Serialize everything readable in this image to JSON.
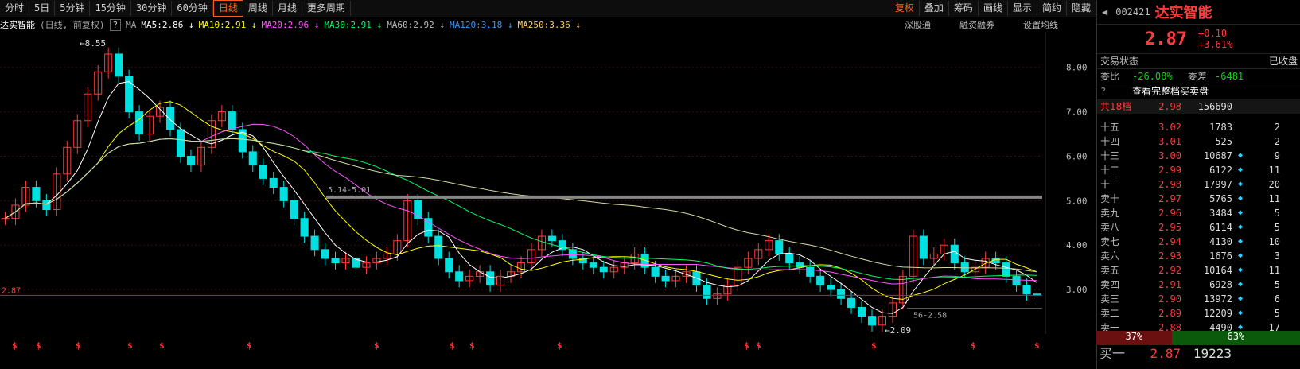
{
  "toolbar": {
    "periods": [
      "分时",
      "5日",
      "5分钟",
      "15分钟",
      "30分钟",
      "60分钟",
      "日线",
      "周线",
      "月线",
      "更多周期"
    ],
    "active": "日线",
    "right": [
      "复权",
      "叠加",
      "筹码",
      "画线",
      "显示",
      "简约",
      "隐藏"
    ]
  },
  "infobar": {
    "stock": "达实智能",
    "mode": "(日线, 前复权)",
    "ma": [
      "MA5:2.86",
      "MA10:2.91",
      "MA20:2.96",
      "MA30:2.91",
      "MA60:2.92",
      "MA120:3.18",
      "MA250:3.36"
    ],
    "ma_colors": [
      "#ffffff",
      "#ffff00",
      "#ff55ff",
      "#00ff66",
      "#c0c0c0",
      "#3399ff",
      "#ffcc66"
    ],
    "links": [
      "深股通",
      "融资融券",
      "设置均线"
    ]
  },
  "chart_data": {
    "type": "candlestick",
    "y_ticks": [
      "8.00",
      "7.00",
      "6.00",
      "5.00",
      "4.00",
      "3.00"
    ],
    "ylim": [
      2.0,
      8.8
    ],
    "annotations": {
      "high_label": "8.55",
      "low_label": "2.09",
      "range_label": "5.14-5.01",
      "level_label": "56-2.58",
      "price_line_label": "2.87"
    },
    "closes": [
      4.6,
      4.9,
      5.3,
      5.0,
      4.8,
      5.6,
      6.2,
      6.8,
      7.4,
      7.9,
      8.3,
      7.8,
      7.0,
      6.5,
      6.9,
      7.1,
      6.6,
      6.0,
      5.8,
      6.2,
      6.8,
      7.0,
      6.6,
      6.1,
      5.8,
      5.5,
      5.3,
      5.0,
      4.6,
      4.2,
      3.9,
      3.7,
      3.6,
      3.7,
      3.5,
      3.6,
      3.7,
      3.8,
      4.1,
      5.0,
      4.6,
      4.2,
      3.7,
      3.4,
      3.2,
      3.3,
      3.4,
      3.1,
      3.3,
      3.4,
      3.6,
      3.9,
      4.2,
      4.1,
      3.9,
      3.7,
      3.6,
      3.5,
      3.4,
      3.5,
      3.6,
      3.8,
      3.5,
      3.3,
      3.2,
      3.3,
      3.4,
      3.1,
      2.8,
      2.9,
      3.1,
      3.5,
      3.7,
      3.9,
      4.1,
      3.8,
      3.6,
      3.5,
      3.3,
      3.1,
      3.0,
      2.8,
      2.6,
      2.4,
      2.2,
      2.4,
      2.7,
      3.3,
      4.2,
      3.7,
      3.8,
      4.0,
      3.6,
      3.4,
      3.5,
      3.7,
      3.6,
      3.3,
      3.1,
      2.9,
      2.87
    ],
    "markers": [
      "$",
      "$",
      "$",
      "$",
      "$",
      "$",
      "$",
      "$",
      "$",
      "$",
      "$",
      "$",
      "$",
      "$",
      "$"
    ]
  },
  "panel": {
    "code": "002421",
    "name": "达实智能",
    "price": "2.87",
    "change": "+0.10",
    "pct": "+3.61%",
    "status_label": "交易状态",
    "status": "已收盘",
    "ratio_label": "委比",
    "ratio": "-26.08%",
    "diff_label": "委差",
    "diff": "-6481",
    "full_book": "查看完整档买卖盘",
    "total_label": "共18档",
    "total_price": "2.98",
    "total_vol": "156690",
    "asks": [
      [
        "十五",
        "3.02",
        "1783",
        "",
        "2"
      ],
      [
        "十四",
        "3.01",
        "525",
        "",
        "2"
      ],
      [
        "十三",
        "3.00",
        "10687",
        "◆",
        "9"
      ],
      [
        "十二",
        "2.99",
        "6122",
        "◆",
        "11"
      ],
      [
        "十一",
        "2.98",
        "17997",
        "◆",
        "20"
      ],
      [
        "卖十",
        "2.97",
        "5765",
        "◆",
        "11"
      ],
      [
        "卖九",
        "2.96",
        "3484",
        "◆",
        "5"
      ],
      [
        "卖八",
        "2.95",
        "6114",
        "◆",
        "5"
      ],
      [
        "卖七",
        "2.94",
        "4130",
        "◆",
        "10"
      ],
      [
        "卖六",
        "2.93",
        "1676",
        "◆",
        "3"
      ],
      [
        "卖五",
        "2.92",
        "10164",
        "◆",
        "11"
      ],
      [
        "卖四",
        "2.91",
        "6928",
        "◆",
        "5"
      ],
      [
        "卖三",
        "2.90",
        "13972",
        "◆",
        "6"
      ],
      [
        "卖二",
        "2.89",
        "12209",
        "◆",
        "5"
      ],
      [
        "卖一",
        "2.88",
        "4490",
        "◆",
        "17"
      ]
    ],
    "bar_left": "37%",
    "bar_right": "63%",
    "bid1": [
      "买一",
      "2.87",
      "19223",
      "◆"
    ]
  }
}
